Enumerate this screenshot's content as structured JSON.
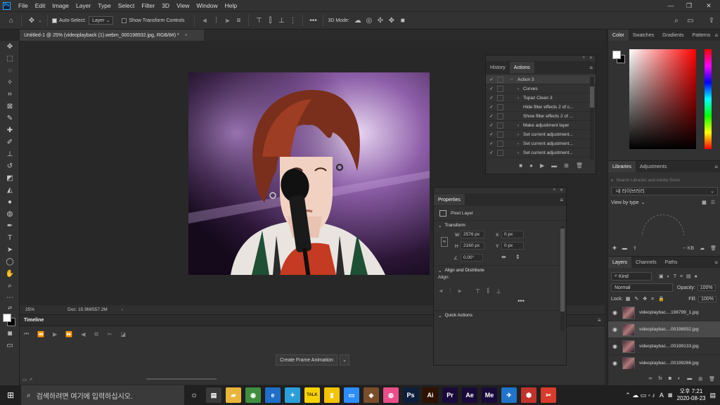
{
  "app": {
    "logo": "Ps"
  },
  "menu": [
    "File",
    "Edit",
    "Image",
    "Layer",
    "Type",
    "Select",
    "Filter",
    "3D",
    "View",
    "Window",
    "Help"
  ],
  "window_controls": [
    "—",
    "❐",
    "✕"
  ],
  "options": {
    "auto_select_label": "Auto-Select:",
    "auto_select_target": "Layer",
    "show_transform_label": "Show Transform Controls",
    "mode_3d_label": "3D Mode:"
  },
  "document_tab": {
    "title": "Untitled-1 @ 25% (videoplayback (1).webm_000198932.jpg, RGB/8#) *",
    "close": "×"
  },
  "status": {
    "zoom": "25%",
    "doc": "Doc: 15.9M/557.2M"
  },
  "timeline": {
    "title": "Timeline",
    "create_button": "Create Frame Animation"
  },
  "history_panel": {
    "tabs": [
      "History",
      "Actions"
    ],
    "actions": [
      {
        "label": "Action 3",
        "expand": "⌵"
      },
      {
        "label": "Curves",
        "expand": "›"
      },
      {
        "label": "Topaz Clean 3",
        "expand": "›"
      },
      {
        "label": "Hide filter effects 2 of c...",
        "expand": ""
      },
      {
        "label": "Show filter effects 2 of ...",
        "expand": ""
      },
      {
        "label": "Make adjustment layer",
        "expand": "›"
      },
      {
        "label": "Set current adjustment...",
        "expand": "›"
      },
      {
        "label": "Set current adjustment...",
        "expand": "›"
      },
      {
        "label": "Set current adjustment...",
        "expand": "›"
      }
    ]
  },
  "properties": {
    "title": "Properties",
    "kind": "Pixel Layer",
    "transform_label": "Transform",
    "w_label": "W",
    "w": "2576 px",
    "h_label": "H",
    "h": "2160 px",
    "x_label": "X",
    "x": "0 px",
    "y_label": "Y",
    "y": "0 px",
    "angle": "0.00°",
    "align_label": "Align and Distribute",
    "align_sub": "Align:",
    "quick_actions": "Quick Actions"
  },
  "color_panel": {
    "tabs": [
      "Color",
      "Swatches",
      "Gradients",
      "Patterns"
    ]
  },
  "libraries": {
    "tabs": [
      "Libraries",
      "Adjustments"
    ],
    "search_placeholder": "Search Libraries and Adobe Stock",
    "library_name": "내 라이브러리",
    "view_by": "View by type",
    "size": "-- KB"
  },
  "layers_panel": {
    "tabs": [
      "Layers",
      "Channels",
      "Paths"
    ],
    "kind": "Kind",
    "blend": "Normal",
    "opacity_label": "Opacity:",
    "opacity": "100%",
    "lock_label": "Lock:",
    "fill_label": "Fill:",
    "fill": "100%",
    "layers": [
      {
        "name": "videoplaybac....198799_1.jpg"
      },
      {
        "name": "videoplaybac....00198932.jpg"
      },
      {
        "name": "videoplaybac....00199133.jpg"
      },
      {
        "name": "videoplaybac....00199266.jpg"
      }
    ]
  },
  "taskbar": {
    "search_placeholder": "검색하려면 여기에 입력하십시오.",
    "apps": [
      {
        "label": "▤",
        "color": "#3a3a3a"
      },
      {
        "label": "▰",
        "color": "#e8b53a"
      },
      {
        "label": "◉",
        "color": "#3f8f3f"
      },
      {
        "label": "e",
        "color": "#1e6fc7"
      },
      {
        "label": "✦",
        "color": "#2b9fd9"
      },
      {
        "label": "TALK",
        "color": "#f6d200"
      },
      {
        "label": "▮",
        "color": "#f4c400"
      },
      {
        "label": "▭",
        "color": "#2d8cff"
      },
      {
        "label": "◈",
        "color": "#7a4e2a"
      },
      {
        "label": "◍",
        "color": "#e94e8a"
      },
      {
        "label": "Ps",
        "color": "#0d1f3c"
      },
      {
        "label": "Ai",
        "color": "#2e1200"
      },
      {
        "label": "Pr",
        "color": "#1a0a3a"
      },
      {
        "label": "Ae",
        "color": "#1a0a3a"
      },
      {
        "label": "Me",
        "color": "#1a0a3a"
      },
      {
        "label": "✈",
        "color": "#1f73c9"
      },
      {
        "label": "⬢",
        "color": "#c0342c"
      },
      {
        "label": "✂",
        "color": "#d83b2b"
      }
    ],
    "tray_ime": "A",
    "time": "오후 7:21",
    "date": "2020-08-23"
  }
}
